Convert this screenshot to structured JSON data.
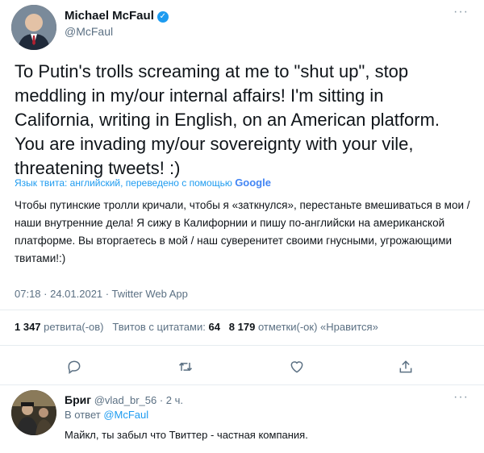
{
  "tweet": {
    "author_name": "Michael McFaul",
    "author_handle": "@McFaul",
    "text": "To Putin's trolls screaming at me to \"shut up\", stop meddling in my/our internal affairs!  I'm sitting in California, writing in English, on an American platform. You are invading my/our sovereignty with your vile, threatening tweets! :)",
    "translate_label": "Язык твита: английский, переведено с помощью",
    "translate_provider": "Google",
    "translation": "Чтобы путинские тролли кричали, чтобы я «заткнулся», перестаньте вмешиваться в мои / наши внутренние дела! Я сижу в Калифорнии и пишу по-английски на американской платформе. Вы вторгаетесь в мой / наш суверенитет своими гнусными, угрожающими твитами!:)",
    "meta": "07:18 · 24.01.2021 · Twitter Web App",
    "retweets_count": "1 347",
    "retweets_label": "ретвита(-ов)",
    "quotes_label": "Твитов с цитатами:",
    "quotes_count": "64",
    "likes_count": "8 179",
    "likes_label": "отметки(-ок) «Нравится»"
  },
  "reply": {
    "name": "Бриг",
    "handle_time": "@vlad_br_56 · 2 ч.",
    "in_reply_prefix": "В ответ",
    "in_reply_handle": "@McFaul",
    "text": "Майкл, ты забыл что Твиттер - частная компания."
  },
  "icons": [
    "avatar",
    "verified-badge-icon",
    "more-icon",
    "reply-icon",
    "retweet-icon",
    "like-icon",
    "share-icon"
  ],
  "colors": {
    "accent": "#1d9bf0",
    "muted": "#5b7083",
    "divider": "#e6ecf0"
  }
}
